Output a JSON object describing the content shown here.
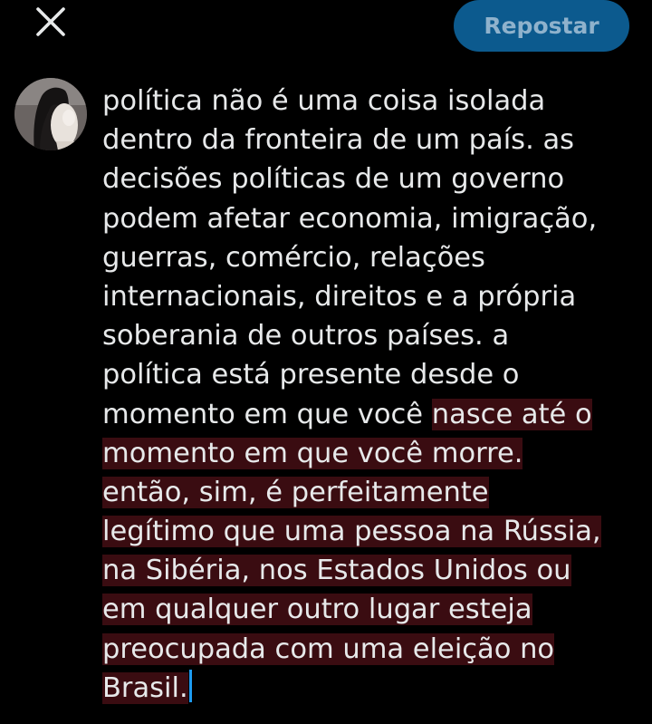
{
  "toolbar": {
    "close_icon": "close-icon",
    "repost_label": "Repostar",
    "repost_color": "#0c5a8e"
  },
  "compose": {
    "avatar_icon": "avatar",
    "highlight_color": "#3a0c11",
    "caret_color": "#1d9bf0",
    "lines": [
      {
        "plain": "política não é uma coisa isolada",
        "highlighted": ""
      },
      {
        "plain": "dentro da fronteira de um país. as",
        "highlighted": ""
      },
      {
        "plain": "decisões políticas de um governo",
        "highlighted": ""
      },
      {
        "plain": "podem afetar economia, imigração,",
        "highlighted": ""
      },
      {
        "plain": "guerras, comércio, relações",
        "highlighted": ""
      },
      {
        "plain": "internacionais, direitos e a própria",
        "highlighted": ""
      },
      {
        "plain": "soberania de outros países. a",
        "highlighted": ""
      },
      {
        "plain": "política está presente desde o",
        "highlighted": ""
      },
      {
        "plain": "momento em que você ",
        "highlighted": "nasce até o"
      },
      {
        "plain": "",
        "highlighted": "momento em que você morre."
      },
      {
        "plain": "",
        "highlighted": "então, sim, é perfeitamente"
      },
      {
        "plain": "",
        "highlighted": "legítimo que uma pessoa na Rússia,"
      },
      {
        "plain": "",
        "highlighted": "na Sibéria, nos Estados Unidos ou"
      },
      {
        "plain": "",
        "highlighted": "em qualquer outro lugar esteja"
      },
      {
        "plain": "",
        "highlighted": "preocupada com uma eleição no"
      },
      {
        "plain": "",
        "highlighted": "Brasil."
      }
    ]
  }
}
